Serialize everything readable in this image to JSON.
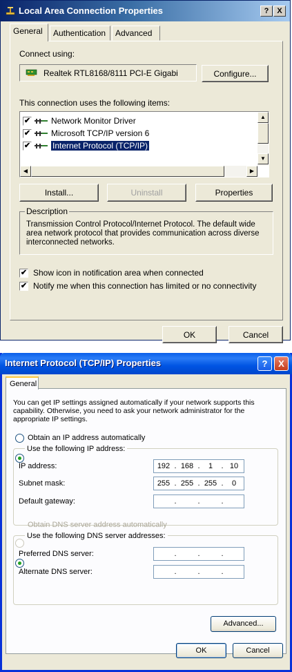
{
  "dialog1": {
    "title": "Local Area Connection Properties",
    "help_button": "?",
    "close_button": "X",
    "tabs": [
      "General",
      "Authentication",
      "Advanced"
    ],
    "connect_using_label": "Connect using:",
    "adapter_name": "Realtek RTL8168/8111 PCI-E Gigabi",
    "configure_button": "Configure...",
    "items_label": "This connection uses the following items:",
    "items": [
      {
        "label": "Network Monitor Driver",
        "checked": true,
        "selected": false
      },
      {
        "label": "Microsoft TCP/IP version 6",
        "checked": true,
        "selected": false
      },
      {
        "label": "Internet Protocol (TCP/IP)",
        "checked": true,
        "selected": true
      }
    ],
    "install_button": "Install...",
    "uninstall_button": "Uninstall",
    "properties_button": "Properties",
    "description_title": "Description",
    "description_text": "Transmission Control Protocol/Internet Protocol. The default wide area network protocol that provides communication across diverse interconnected networks.",
    "show_icon_label": "Show icon in notification area when connected",
    "notify_label": "Notify me when this connection has limited or no connectivity",
    "ok_button": "OK",
    "cancel_button": "Cancel"
  },
  "dialog2": {
    "title": "Internet Protocol (TCP/IP) Properties",
    "help_button": "?",
    "close_button": "X",
    "tab": "General",
    "info_text": "You can get IP settings assigned automatically if your network supports this capability. Otherwise, you need to ask your network administrator for the appropriate IP settings.",
    "obtain_ip_auto": "Obtain an IP address automatically",
    "use_following_ip": "Use the following IP address:",
    "ip_label": "IP address:",
    "subnet_label": "Subnet mask:",
    "gateway_label": "Default gateway:",
    "ip_address": [
      "192",
      "168",
      "1",
      "10"
    ],
    "subnet_mask": [
      "255",
      "255",
      "255",
      "0"
    ],
    "default_gateway": [
      "",
      "",
      "",
      ""
    ],
    "obtain_dns_auto": "Obtain DNS server address automatically",
    "use_following_dns": "Use the following DNS server addresses:",
    "preferred_dns_label": "Preferred DNS server:",
    "alternate_dns_label": "Alternate DNS server:",
    "preferred_dns": [
      "",
      "",
      "",
      ""
    ],
    "alternate_dns": [
      "",
      "",
      "",
      ""
    ],
    "advanced_button": "Advanced...",
    "ok_button": "OK",
    "cancel_button": "Cancel"
  },
  "colors": {
    "classic_title": "#0a246a",
    "xp_title": "#0054e3",
    "dialog_bg": "#ece9d8",
    "selection": "#0a246a"
  }
}
